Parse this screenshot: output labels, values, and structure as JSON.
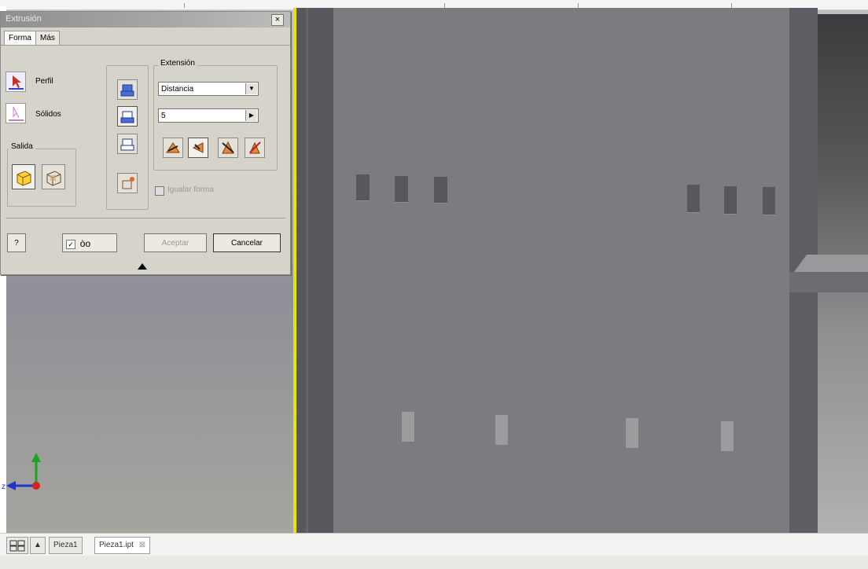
{
  "dialog": {
    "title": "Extrusión",
    "close_label": "×",
    "tabs": [
      "Forma",
      "Más"
    ],
    "profile_label": "Perfil",
    "solids_label": "Sólidos",
    "output_group_label": "Salida",
    "extension_group_label": "Extensión",
    "extension_type_value": "Distancia",
    "distance_value": "5",
    "match_shape_label": "Igualar forma",
    "help_label": "?",
    "preview_glasses": "òo",
    "ok_label": "Aceptar",
    "cancel_label": "Cancelar"
  },
  "statusbar": {
    "tabs": [
      "Pieza1",
      "Pieza1.ipt"
    ],
    "tab_close_icon": "close-icon"
  },
  "colors": {
    "highlight_edge": "#e5e600",
    "face": "#7c7c80",
    "dialog_bg": "#d6d3ca"
  }
}
